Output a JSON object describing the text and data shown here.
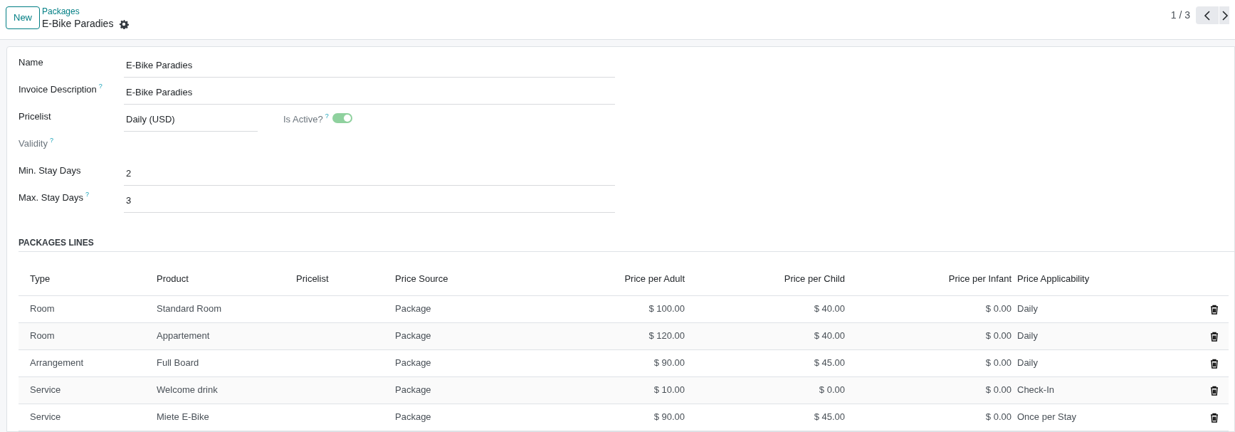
{
  "header": {
    "new_button": "New",
    "breadcrumb": "Packages",
    "record_title": "E-Bike Paradies",
    "pager": "1 / 3"
  },
  "form": {
    "fields": [
      {
        "kind": "text",
        "label": "Name",
        "value": "E-Bike Paradies"
      },
      {
        "kind": "text",
        "label": "Invoice Description",
        "help": "?",
        "value": "E-Bike Paradies"
      },
      {
        "kind": "pricelist",
        "label": "Pricelist",
        "value": "Daily (USD)",
        "toggle_label": "Is Active?",
        "toggle_help": "?",
        "on": true
      },
      {
        "kind": "heading",
        "label": "Validity",
        "help": "?"
      },
      {
        "kind": "text",
        "label": "Min. Stay Days",
        "value": "2"
      },
      {
        "kind": "text",
        "label": "Max. Stay Days",
        "help": "?",
        "value": "3"
      }
    ]
  },
  "section_title": "PACKAGES LINES",
  "table": {
    "columns": [
      "Type",
      "Product",
      "Pricelist",
      "Price Source",
      "Price per Adult",
      "Price per Child",
      "Price per Infant",
      "Price Applicability"
    ],
    "rows": [
      [
        "Room",
        "Standard Room",
        "",
        "Package",
        "$ 100.00",
        "$ 40.00",
        "$ 0.00",
        "Daily"
      ],
      [
        "Room",
        "Appartement",
        "",
        "Package",
        "$ 120.00",
        "$ 40.00",
        "$ 0.00",
        "Daily"
      ],
      [
        "Arrangement",
        "Full Board",
        "",
        "Package",
        "$ 90.00",
        "$ 45.00",
        "$ 0.00",
        "Daily"
      ],
      [
        "Service",
        "Welcome drink",
        "",
        "Package",
        "$ 10.00",
        "$ 0.00",
        "$ 0.00",
        "Check-In"
      ],
      [
        "Service",
        "Miete E-Bike",
        "",
        "Package",
        "$ 90.00",
        "$ 45.00",
        "$ 0.00",
        "Once per Stay"
      ]
    ]
  }
}
